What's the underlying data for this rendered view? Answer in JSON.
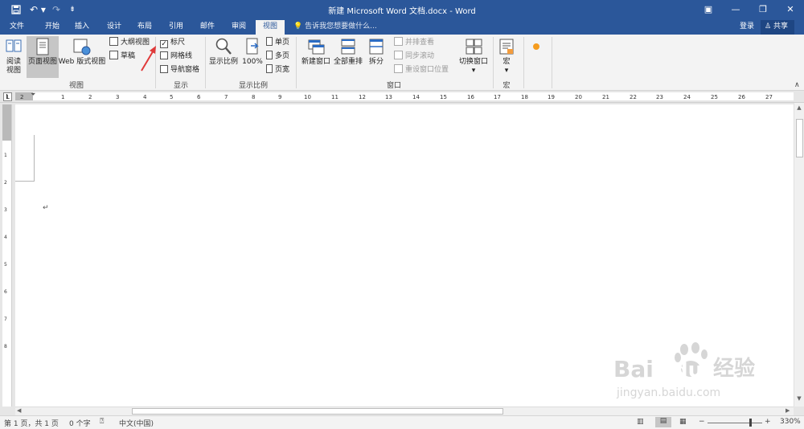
{
  "window": {
    "title": "新建 Microsoft Word 文档.docx - Word",
    "controls": [
      "ribbon-display-icon",
      "minimize-icon",
      "restore-icon",
      "close-icon"
    ]
  },
  "quick_access": [
    "save-icon",
    "undo-icon",
    "redo-icon",
    "customize-icon"
  ],
  "menu": {
    "tabs": [
      "文件",
      "开始",
      "插入",
      "设计",
      "布局",
      "引用",
      "邮件",
      "审阅",
      "视图"
    ],
    "active_tab": "视图",
    "tell_me": "告诉我您想要做什么...",
    "login": "登录",
    "share": "共享"
  },
  "ribbon": {
    "views": {
      "read_mode": "阅读\n视图",
      "print_layout": "页面视图",
      "web_layout": "Web 版式视图",
      "outline": "大纲视图",
      "draft": "草稿",
      "group": "视图"
    },
    "show": {
      "ruler": "标尺",
      "ruler_checked": true,
      "gridlines": "网格线",
      "gridlines_checked": false,
      "nav_pane": "导航窗格",
      "nav_pane_checked": false,
      "group": "显示"
    },
    "zoom": {
      "zoom": "显示比例",
      "hundred": "100%",
      "one_page": "单页",
      "multi_page": "多页",
      "page_width": "页宽",
      "group": "显示比例"
    },
    "window": {
      "new_window": "新建窗口",
      "arrange_all": "全部重排",
      "split": "拆分",
      "side_by_side": "并排查看",
      "sync_scroll": "同步滚动",
      "reset_pos": "重设窗口位置",
      "switch_windows": "切换窗口",
      "group": "窗口"
    },
    "macros": {
      "macro": "宏",
      "group": "宏"
    }
  },
  "ruler": {
    "h_labels": [
      "1",
      "2",
      "1",
      "2",
      "3",
      "4",
      "5",
      "6",
      "7",
      "8",
      "9",
      "10",
      "11",
      "12",
      "13",
      "14",
      "15",
      "16",
      "17",
      "18",
      "19",
      "20",
      "21",
      "22",
      "23",
      "24",
      "25",
      "26",
      "27"
    ],
    "v_labels": [
      "1",
      "2",
      "3",
      "4",
      "5",
      "6",
      "7",
      "8"
    ]
  },
  "statusbar": {
    "page": "第 1 页，共 1 页",
    "words": "0 个字",
    "lang": "中文(中国)",
    "zoom": "330%"
  },
  "colors": {
    "brand": "#2b579a",
    "accent": "#e03a3a",
    "ribbon": "#f3f3f3"
  }
}
